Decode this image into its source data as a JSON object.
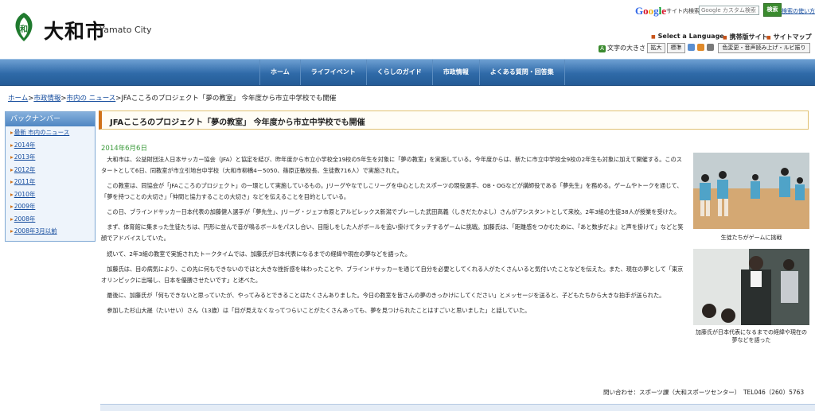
{
  "header": {
    "site_name": "大和市",
    "site_name_en": "Yamato City",
    "google": "Google",
    "site_search_label": "サイト内検索",
    "search_placeholder": "Google カスタム検索",
    "search_button": "検索",
    "search_help": "検索の使い方",
    "utility_links": [
      "Select a Language",
      "携帯版サイト",
      "サイトマップ"
    ],
    "font_size_label": "文字の大きさ",
    "font_size_buttons": [
      "拡大",
      "標準"
    ],
    "accessibility_button": "色変更・音声読み上げ・ルビ振り"
  },
  "nav": {
    "items": [
      "ホーム",
      "ライフイベント",
      "くらしのガイド",
      "市政情報",
      "よくある質問・回答集"
    ]
  },
  "breadcrumb": {
    "links": [
      "ホーム",
      "市政情報",
      "市内の ニュース"
    ],
    "current": "JFAこころのプロジェクト「夢の教室」 今年度から市立中学校でも開催"
  },
  "sidebar": {
    "title": "バックナンバー",
    "items": [
      "最新 市内のニュース",
      "2014年",
      "2013年",
      "2012年",
      "2011年",
      "2010年",
      "2009年",
      "2008年",
      "2008年3月以前"
    ]
  },
  "article": {
    "title": "JFAこころのプロジェクト「夢の教室」 今年度から市立中学校でも開催",
    "date": "2014年6月6日",
    "paragraphs": [
      "大和市は、公益財団法人日本サッカー協会（JFA）と協定を結び、昨年度から市立小学校全19校の5年生を対象に「夢の教室」を実施している。今年度からは、新たに市立中学校全9校の2年生も対象に加えて開催する。このスタートとして6日、同教室が市立引地台中学校（大和市柳橋4－5050、篠原正敏校長、生徒数716人）で実施された。",
      "この教室は、同協会が「JFAこころのプロジェクト」の一環として実施しているもの。Jリーグやなでしこリーグを中心としたスポーツの現役選手、OB・OGなどが講師役である「夢先生」を務める。ゲームやトークを通じて、「夢を持つことの大切さ」「仲間と協力することの大切さ」などを伝えることを目的としている。",
      "この日、ブラインドサッカー日本代表の加藤健人選手が「夢先生」、Jリーグ・ジェフ市原とアルビレックス新潟でプレーした武田高義（しきだたかよし）さんがアシスタントとして来校。2年3組の生徒38人が授業を受けた。",
      "まず、体育館に集まった生徒たちは、円形に並んで音が鳴るボールをパスし合い、目隠しをした人がボールを追い掛けてタッチするゲームに挑戦。加藤氏は、「距離感をつかむために、『あと数歩だよ』と声を掛けて」などと笑顔でアドバイスしていた。",
      "続いて、2年3組の教室で実施されたトークタイムでは、加藤氏が日本代表になるまでの経緯や現在の夢などを語った。",
      "加藤氏は、目の病気により、この先に何もできないのではと大きな挫折感を味わったことや、ブラインドサッカーを通じて自分を必要としてくれる人がたくさんいると気付いたことなどを伝えた。また、現在の夢として「東京オリンピックに出場し、日本を優勝させたいです」と述べた。",
      "最後に、加藤氏が「何もできないと思っていたが、やってみるとできることはたくさんありました。今日の教室を皆さんの夢のきっかけにしてください」とメッセージを送ると、子どもたちから大きな拍手が送られた。",
      "参加した杉山大晟（たいせい）さん（13歳）は「目が見えなくなってつらいことがたくさんあっても、夢を見つけられたことはすごいと思いました」と話していた。"
    ],
    "photos": [
      {
        "caption": "生徒たちがゲームに挑戦"
      },
      {
        "caption": "加藤氏が日本代表になるまでの経緯や現在の夢などを語った"
      }
    ],
    "contact": "問い合わせ：スポーツ課（大和スポーツセンター）　TEL046（260）5763"
  },
  "colors": {
    "nav": "#2f6aa8",
    "accent": "#d0721a",
    "link": "#124a9c",
    "date": "#3a9a3a"
  }
}
